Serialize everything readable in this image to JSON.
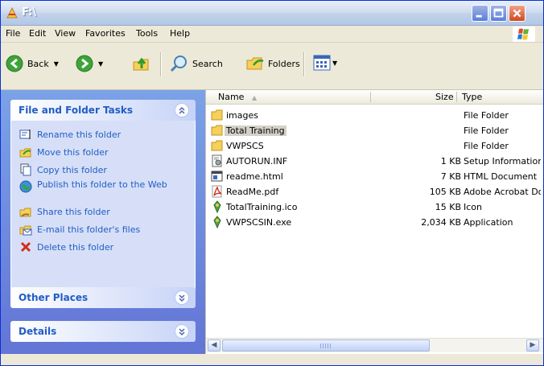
{
  "window": {
    "title": "F:\\"
  },
  "menu": {
    "file": "File",
    "edit": "Edit",
    "view": "View",
    "favorites": "Favorites",
    "tools": "Tools",
    "help": "Help"
  },
  "toolbar": {
    "back": "Back",
    "search": "Search",
    "folders": "Folders"
  },
  "tasks": {
    "file_folder": {
      "title": "File and Folder Tasks",
      "items": [
        {
          "label": "Rename this folder",
          "icon": "rename-icon"
        },
        {
          "label": "Move this folder",
          "icon": "move-icon"
        },
        {
          "label": "Copy this folder",
          "icon": "copy-icon"
        },
        {
          "label": "Publish this folder to the Web",
          "icon": "publish-web-icon"
        },
        {
          "label": "Share this folder",
          "icon": "share-icon"
        },
        {
          "label": "E-mail this folder's files",
          "icon": "email-icon"
        },
        {
          "label": "Delete this folder",
          "icon": "delete-icon"
        }
      ]
    },
    "other_places": {
      "title": "Other Places"
    },
    "details": {
      "title": "Details"
    }
  },
  "list": {
    "columns": {
      "name": "Name",
      "size": "Size",
      "type": "Type"
    },
    "rows": [
      {
        "name": "images",
        "size": "",
        "type": "File Folder",
        "icon": "folder-icon"
      },
      {
        "name": "Total Training",
        "size": "",
        "type": "File Folder",
        "icon": "folder-icon"
      },
      {
        "name": "VWPSCS",
        "size": "",
        "type": "File Folder",
        "icon": "folder-icon"
      },
      {
        "name": "AUTORUN.INF",
        "size": "1 KB",
        "type": "Setup Information",
        "icon": "setup-file-icon"
      },
      {
        "name": "readme.html",
        "size": "7 KB",
        "type": "HTML Document",
        "icon": "html-file-icon"
      },
      {
        "name": "ReadMe.pdf",
        "size": "105 KB",
        "type": "Adobe Acrobat Document",
        "icon": "pdf-file-icon"
      },
      {
        "name": "TotalTraining.ico",
        "size": "15 KB",
        "type": "Icon",
        "icon": "ico-file-icon"
      },
      {
        "name": "VWPSCSIN.exe",
        "size": "2,034 KB",
        "type": "Application",
        "icon": "exe-file-icon"
      }
    ],
    "selected_index": 1
  },
  "colors": {
    "accent": "#215dc6",
    "task_gradient_top": "#7ba2e7",
    "task_gradient_bottom": "#6375d6"
  }
}
